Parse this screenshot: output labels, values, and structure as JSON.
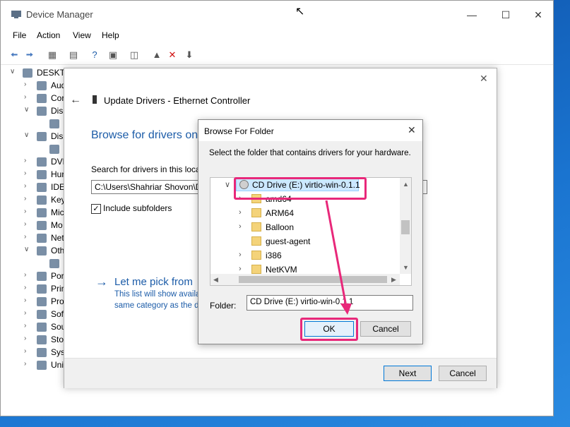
{
  "colors": {
    "accent": "#0078d7",
    "link": "#1c5ca8",
    "annotation": "#e8287a",
    "selection": "#cce8ff"
  },
  "device_manager": {
    "title": "Device Manager",
    "menu": [
      "File",
      "Action",
      "View",
      "Help"
    ],
    "toolbar_icons": [
      "back-icon",
      "forward-icon",
      "properties-icon",
      "devices-icon",
      "help-icon",
      "display-icon",
      "scan-icon",
      "disable-icon",
      "uninstall-icon",
      "update-driver-icon"
    ],
    "tree": [
      {
        "label": "DESKTO",
        "chevron": "v"
      },
      {
        "label": "Aud",
        "chevron": ">"
      },
      {
        "label": "Cor",
        "chevron": ">"
      },
      {
        "label": "Disk",
        "chevron": "v"
      },
      {
        "label": "",
        "chevron": ""
      },
      {
        "label": "Disp",
        "chevron": "v"
      },
      {
        "label": "",
        "chevron": ""
      },
      {
        "label": "DVD",
        "chevron": ">"
      },
      {
        "label": "Hur",
        "chevron": ">"
      },
      {
        "label": "IDE",
        "chevron": ">"
      },
      {
        "label": "Key",
        "chevron": ">"
      },
      {
        "label": "Mic",
        "chevron": ">"
      },
      {
        "label": "Mo",
        "chevron": ">"
      },
      {
        "label": "Net",
        "chevron": ">"
      },
      {
        "label": "Oth",
        "chevron": "v"
      },
      {
        "label": "",
        "chevron": ""
      },
      {
        "label": "Por",
        "chevron": ">"
      },
      {
        "label": "Prir",
        "chevron": ">"
      },
      {
        "label": "Pro",
        "chevron": ">"
      },
      {
        "label": "Soft",
        "chevron": ">"
      },
      {
        "label": "Sou",
        "chevron": ">"
      },
      {
        "label": "Stor",
        "chevron": ">"
      },
      {
        "label": "Syst",
        "chevron": ">"
      },
      {
        "label": "Uni",
        "chevron": ">"
      }
    ]
  },
  "update_drivers": {
    "title": "Update Drivers - Ethernet Controller",
    "heading": "Browse for drivers on",
    "search_label": "Search for drivers in this loca",
    "path_value": "C:\\Users\\Shahriar Shovon\\D",
    "include_subfolders": "Include subfolders",
    "pick_title": "Let me pick from",
    "pick_desc_1": "This list will show availa",
    "pick_desc_2": "same category as the d",
    "next": "Next",
    "cancel": "Cancel"
  },
  "browse_folder": {
    "title": "Browse For Folder",
    "instruction": "Select the folder that contains drivers for your hardware.",
    "drive": "CD Drive (E:) virtio-win-0.1.1",
    "folders": [
      {
        "label": "amd64",
        "chevron": true
      },
      {
        "label": "ARM64",
        "chevron": true
      },
      {
        "label": "Balloon",
        "chevron": true
      },
      {
        "label": "guest-agent",
        "chevron": false
      },
      {
        "label": "i386",
        "chevron": true
      },
      {
        "label": "NetKVM",
        "chevron": true
      }
    ],
    "folder_label": "Folder:",
    "folder_value": "CD Drive (E:) virtio-win-0.1.1",
    "ok": "OK",
    "cancel": "Cancel"
  }
}
